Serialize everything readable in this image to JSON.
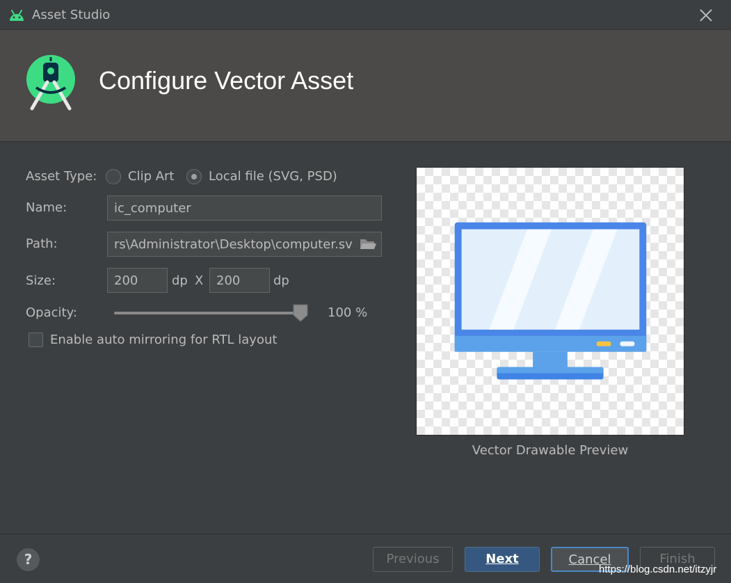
{
  "window": {
    "title": "Asset Studio",
    "app_icon": "android-icon",
    "close_icon": "close-icon"
  },
  "header": {
    "title": "Configure Vector Asset",
    "logo": "android-studio-logo"
  },
  "form": {
    "asset_type_label": "Asset Type:",
    "asset_type_options": [
      {
        "label": "Clip Art",
        "checked": false
      },
      {
        "label": "Local file (SVG, PSD)",
        "checked": true
      }
    ],
    "name_label": "Name:",
    "name_value": "ic_computer",
    "path_label": "Path:",
    "path_value": "rs\\Administrator\\Desktop\\computer.svg",
    "path_button_icon": "folder-icon",
    "size_label": "Size:",
    "width_value": "200",
    "height_value": "200",
    "unit_width": "dp",
    "size_separator": "X",
    "unit_height": "dp",
    "opacity_label": "Opacity:",
    "opacity_value": 100,
    "opacity_text": "100 %",
    "rtl_label": "Enable auto mirroring for RTL layout",
    "rtl_checked": false
  },
  "preview": {
    "label": "Vector Drawable Preview",
    "image": "computer-monitor-icon"
  },
  "footer": {
    "help_label": "?",
    "previous_label": "Previous",
    "next_label": "Next",
    "cancel_label": "Cancel",
    "finish_label": "Finish"
  },
  "watermark": "https://blog.csdn.net/itzyjr",
  "colors": {
    "accent": "#4a88c7",
    "primary_button": "#365880",
    "android_green": "#3ddc84",
    "monitor_blue": "#4a86e8"
  }
}
